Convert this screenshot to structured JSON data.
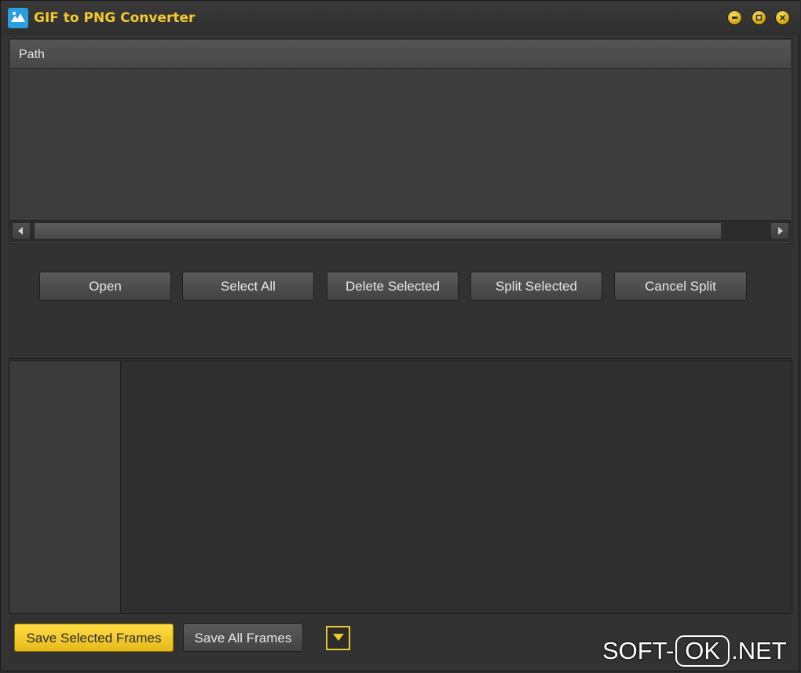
{
  "window": {
    "title": "GIF to PNG Converter",
    "accent_color": "#f3c92f",
    "icons": {
      "app": "app-logo-icon",
      "minimize": "minimize-icon",
      "maximize": "maximize-icon",
      "close": "close-icon"
    }
  },
  "file_list": {
    "column_header": "Path",
    "rows": [],
    "scroll_left_icon": "scroll-left-arrow-icon",
    "scroll_right_icon": "scroll-right-arrow-icon"
  },
  "toolbar": {
    "open_label": "Open",
    "select_all_label": "Select All",
    "delete_selected_label": "Delete Selected",
    "split_selected_label": "Split Selected",
    "cancel_split_label": "Cancel Split"
  },
  "bottom_bar": {
    "save_selected_label": "Save Selected Frames",
    "save_all_label": "Save All Frames",
    "dropdown_icon": "dropdown-arrow-icon"
  },
  "watermark": {
    "prefix": "SOFT-",
    "boxed": "OK",
    "suffix": ".NET"
  }
}
